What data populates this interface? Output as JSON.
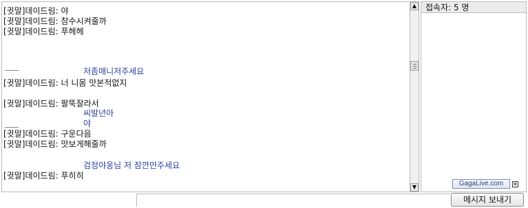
{
  "chat": {
    "messages": [
      {
        "nick": "[귓말]데이드림:",
        "text": "야",
        "private": false
      },
      {
        "nick": "[귓말]데이드림:",
        "text": "참수시켜줄까",
        "private": false
      },
      {
        "nick": "[귓말]데이드림:",
        "text": "푸헤헤",
        "private": false
      },
      {
        "nick": "",
        "text": "저좀매니저주세요",
        "private": true
      },
      {
        "nick": "[귓말]데이드림:",
        "text": "너 니몸 맛본적없지",
        "private": false
      },
      {
        "nick": "[귓말]데이드림:",
        "text": "팔뚝잘라서",
        "private": false
      },
      {
        "nick": "",
        "text": "씨발년아",
        "private": true
      },
      {
        "nick": "",
        "text": "야",
        "private": true
      },
      {
        "nick": "[귓말]데이드림:",
        "text": "구운다음",
        "private": false
      },
      {
        "nick": "[귓말]데이드림:",
        "text": "맛보게해줄까",
        "private": false
      },
      {
        "nick": "",
        "text": "검정야옹님 저 잠깐만주세요",
        "private": true
      },
      {
        "nick": "[귓말]데이드림:",
        "text": "푸히히",
        "private": false
      }
    ]
  },
  "user_panel": {
    "header": "접속자: 5 명",
    "logo_text": "GagaLive.com"
  },
  "input": {
    "value": "",
    "send_label": "메시지 보내기"
  },
  "scrollbar": {
    "up_glyph": "▲",
    "down_glyph": "▼"
  },
  "colors": {
    "private_text": "#2b3fa0",
    "border": "#b9b9b9"
  }
}
